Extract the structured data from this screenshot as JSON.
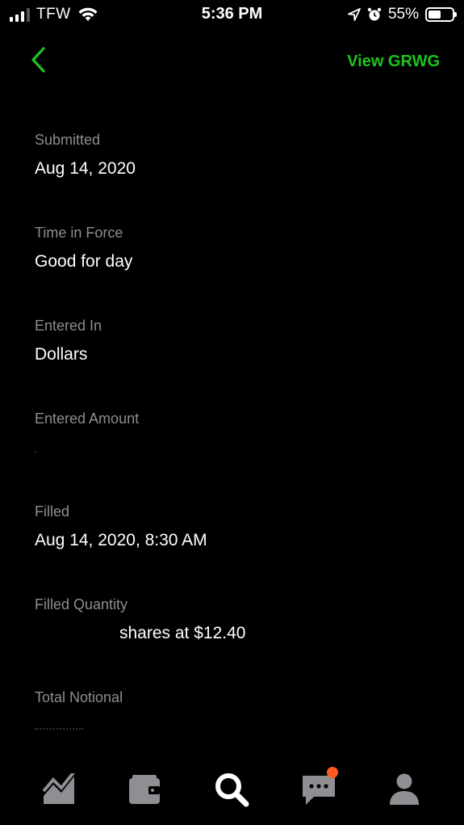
{
  "status_bar": {
    "carrier": "TFW",
    "time": "5:36 PM",
    "battery_percent": "55%",
    "battery_level": 0.55,
    "icons": [
      "signal-icon",
      "wifi-icon",
      "location-icon",
      "alarm-icon",
      "battery-icon"
    ]
  },
  "nav": {
    "back_icon": "chevron-left-icon",
    "view_link": "View GRWG",
    "accent_color": "#1ec41e"
  },
  "details": [
    {
      "label": "Submitted",
      "value": "Aug 14, 2020"
    },
    {
      "label": "Time in Force",
      "value": "Good for day"
    },
    {
      "label": "Entered In",
      "value": "Dollars"
    },
    {
      "label": "Entered Amount",
      "value": ""
    },
    {
      "label": "Filled",
      "value": "Aug 14, 2020, 8:30 AM"
    },
    {
      "label": "Filled Quantity",
      "value": "shares at $12.40"
    },
    {
      "label": "Total Notional",
      "value": ""
    }
  ],
  "tab_bar": {
    "tabs": [
      {
        "icon": "chart-icon",
        "active": false
      },
      {
        "icon": "wallet-icon",
        "active": false
      },
      {
        "icon": "search-icon",
        "active": true
      },
      {
        "icon": "messages-icon",
        "active": false,
        "badge": true
      },
      {
        "icon": "account-icon",
        "active": false
      }
    ],
    "badge_color": "#ff5a1f"
  }
}
